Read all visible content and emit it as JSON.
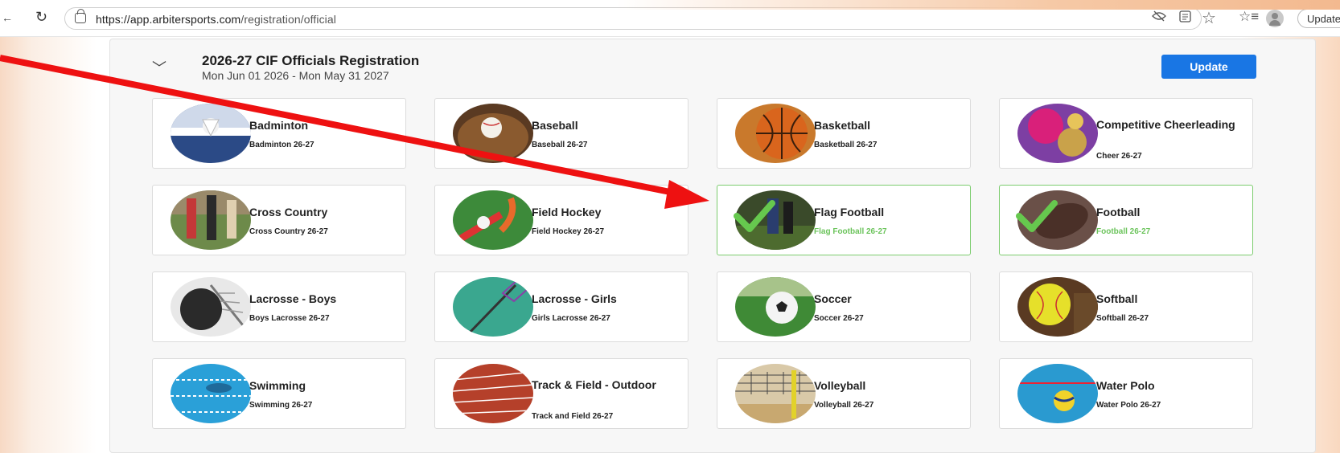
{
  "browser": {
    "url_host": "https://app.arbitersports.com",
    "url_path": "/registration/official",
    "update_label": "Update"
  },
  "registration": {
    "title": "2026-27 CIF Officials Registration",
    "dates": "Mon Jun 01 2026 - Mon May 31 2027",
    "update_button": "Update"
  },
  "accent_color": "#1976e4",
  "selected_color": "#6cc45c",
  "sports": [
    {
      "name": "Badminton",
      "season": "Badminton 26-27",
      "selected": false,
      "icon": "badminton-shuttlecock"
    },
    {
      "name": "Baseball",
      "season": "Baseball 26-27",
      "selected": false,
      "icon": "baseball-glove"
    },
    {
      "name": "Basketball",
      "season": "Basketball 26-27",
      "selected": false,
      "icon": "basketball"
    },
    {
      "name": "Competitive Cheerleading",
      "season": "Cheer 26-27",
      "selected": false,
      "icon": "pom-poms"
    },
    {
      "name": "Cross Country",
      "season": "Cross Country 26-27",
      "selected": false,
      "icon": "runners"
    },
    {
      "name": "Field Hockey",
      "season": "Field Hockey 26-27",
      "selected": false,
      "icon": "field-hockey-stick"
    },
    {
      "name": "Flag Football",
      "season": "Flag Football 26-27",
      "selected": true,
      "icon": "flag-football-players"
    },
    {
      "name": "Football",
      "season": "Football 26-27",
      "selected": true,
      "icon": "football"
    },
    {
      "name": "Lacrosse - Boys",
      "season": "Boys Lacrosse 26-27",
      "selected": false,
      "icon": "lacrosse-helmet"
    },
    {
      "name": "Lacrosse - Girls",
      "season": "Girls Lacrosse 26-27",
      "selected": false,
      "icon": "lacrosse-stick"
    },
    {
      "name": "Soccer",
      "season": "Soccer 26-27",
      "selected": false,
      "icon": "soccer-ball"
    },
    {
      "name": "Softball",
      "season": "Softball 26-27",
      "selected": false,
      "icon": "softball"
    },
    {
      "name": "Swimming",
      "season": "Swimming 26-27",
      "selected": false,
      "icon": "swimming-pool"
    },
    {
      "name": "Track & Field - Outdoor",
      "season": "Track and Field 26-27",
      "selected": false,
      "icon": "running-track"
    },
    {
      "name": "Volleyball",
      "season": "Volleyball 26-27",
      "selected": false,
      "icon": "volleyball-net"
    },
    {
      "name": "Water Polo",
      "season": "Water Polo 26-27",
      "selected": false,
      "icon": "water-polo-ball"
    }
  ]
}
